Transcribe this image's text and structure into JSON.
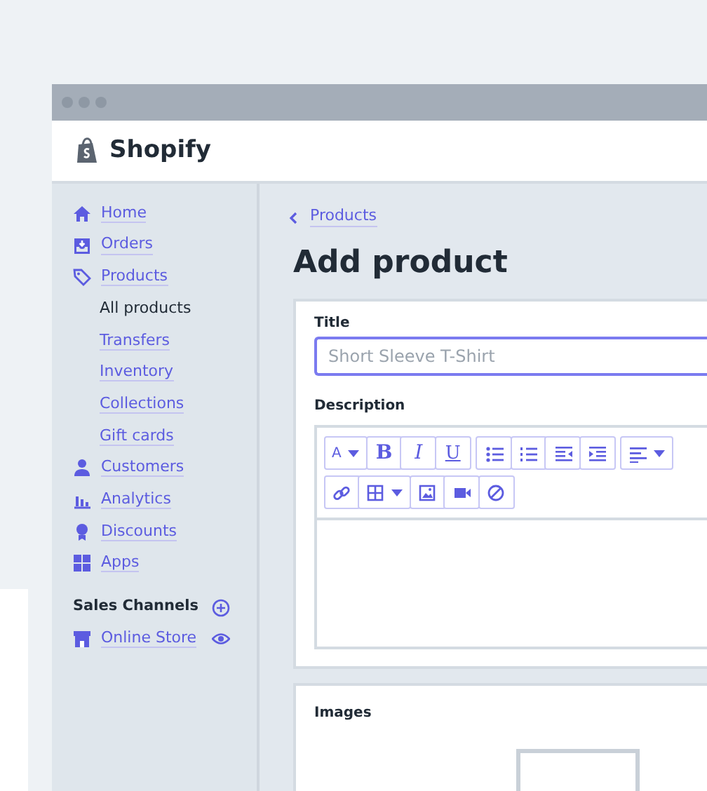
{
  "logo": {
    "text": "Shopify"
  },
  "sidebar": {
    "items": [
      {
        "kind": "home",
        "label": "Home",
        "selected": false
      },
      {
        "kind": "orders",
        "label": "Orders",
        "selected": false
      },
      {
        "kind": "products",
        "label": "Products",
        "selected": false,
        "children": [
          {
            "label": "All products",
            "selected": true
          },
          {
            "label": "Transfers",
            "selected": false
          },
          {
            "label": "Inventory",
            "selected": false
          },
          {
            "label": "Collections",
            "selected": false
          },
          {
            "label": "Gift cards",
            "selected": false
          }
        ]
      },
      {
        "kind": "customers",
        "label": "Customers",
        "selected": false
      },
      {
        "kind": "analytics",
        "label": "Analytics",
        "selected": false
      },
      {
        "kind": "discounts",
        "label": "Discounts",
        "selected": false
      },
      {
        "kind": "apps",
        "label": "Apps",
        "selected": false
      }
    ],
    "sales_channels": {
      "heading": "Sales Channels",
      "items": [
        {
          "kind": "store",
          "label": "Online Store"
        }
      ]
    }
  },
  "breadcrumb": "Products",
  "page_title": "Add product",
  "title_field": {
    "label": "Title",
    "placeholder": "Short Sleeve T-Shirt"
  },
  "description": {
    "label": "Description",
    "toolbar_rows": [
      [
        [
          {
            "kind": "font-size",
            "label": "A"
          },
          {
            "kind": "bold",
            "label": "B"
          },
          {
            "kind": "italic",
            "label": "I"
          },
          {
            "kind": "underline",
            "label": "U"
          }
        ],
        [
          {
            "kind": "bullets"
          },
          {
            "kind": "numbers"
          },
          {
            "kind": "outdent"
          },
          {
            "kind": "indent"
          }
        ],
        [
          {
            "kind": "align"
          }
        ]
      ],
      [
        [
          {
            "kind": "link"
          },
          {
            "kind": "table"
          },
          {
            "kind": "image"
          },
          {
            "kind": "video"
          },
          {
            "kind": "clear"
          }
        ]
      ]
    ]
  },
  "images": {
    "label": "Images"
  }
}
